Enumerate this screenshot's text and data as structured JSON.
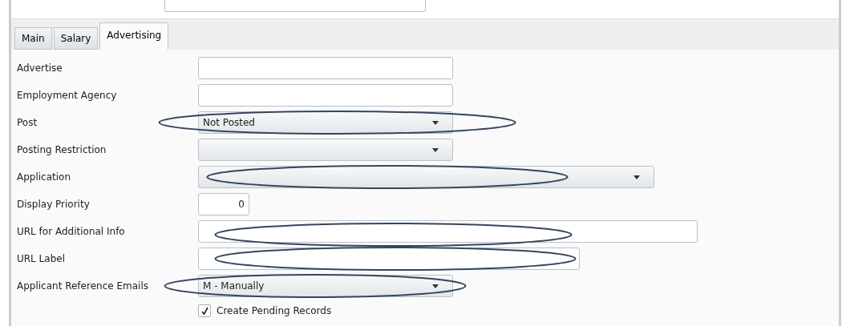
{
  "tabs": [
    {
      "label": "Main",
      "selected": false
    },
    {
      "label": "Salary",
      "selected": false
    },
    {
      "label": "Advertising",
      "selected": true
    }
  ],
  "fields": [
    {
      "label": "Advertise",
      "kind": "text"
    },
    {
      "label": "Employment Agency",
      "kind": "text"
    },
    {
      "label": "Post",
      "kind": "dropdown",
      "value": "Not Posted",
      "highlighted": true
    },
    {
      "label": "Posting Restriction",
      "kind": "dropdown"
    },
    {
      "label": "Application",
      "kind": "dropdown",
      "highlighted": true
    },
    {
      "label": "Display Priority",
      "kind": "number",
      "value": "0"
    },
    {
      "label": "URL for Additional Info",
      "kind": "text",
      "highlighted": true
    },
    {
      "label": "URL Label",
      "kind": "text",
      "highlighted": true
    },
    {
      "label": "Applicant Reference Emails",
      "kind": "dropdown",
      "value": "M - Manually",
      "highlighted": true
    }
  ],
  "checkbox": {
    "label": "Create Pending Records",
    "checked": true
  }
}
